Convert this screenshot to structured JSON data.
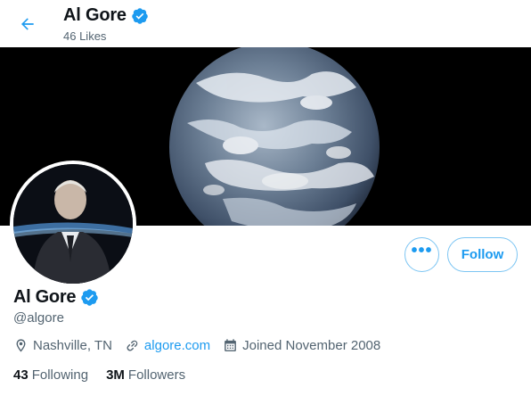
{
  "header": {
    "back_icon": "arrow-left-icon",
    "title": "Al Gore",
    "subtitle": "46 Likes"
  },
  "banner": {
    "description_icon": "earth-globe-image"
  },
  "actions": {
    "more_label": "•••",
    "follow_label": "Follow"
  },
  "profile": {
    "name": "Al Gore",
    "handle": "@algore",
    "verified_icon": "verified-badge-icon",
    "location": "Nashville, TN",
    "website": "algore.com",
    "joined": "Joined November 2008"
  },
  "stats": {
    "following_count": "43",
    "following_label": "Following",
    "followers_count": "3M",
    "followers_label": "Followers"
  },
  "colors": {
    "accent": "#1d9bf0",
    "muted_text": "#536471",
    "text": "#0f1419"
  }
}
